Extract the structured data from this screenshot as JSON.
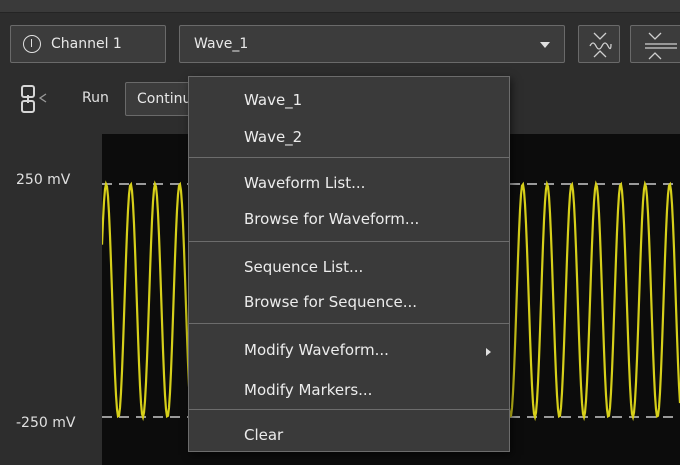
{
  "toolbar": {
    "channel_label": "Channel 1",
    "waveform_selected": "Wave_1",
    "run_label": "Run",
    "run_mode_value": "Continuous"
  },
  "plot": {
    "y_max_label": "250 mV",
    "y_min_label": "-250 mV",
    "trace_color": "#d6cf1a",
    "background_color": "#0c0c0c"
  },
  "menu": {
    "items": [
      {
        "label": "Wave_1"
      },
      {
        "label": "Wave_2"
      },
      {
        "label": "Waveform List..."
      },
      {
        "label": "Browse for Waveform..."
      },
      {
        "label": "Sequence List..."
      },
      {
        "label": "Browse for Sequence..."
      },
      {
        "label": "Modify Waveform...",
        "has_submenu": true
      },
      {
        "label": "Modify Markers..."
      },
      {
        "label": "Clear"
      }
    ]
  },
  "icons": {
    "channel": "power-icon",
    "dropdown": "chevron-down-icon",
    "waveform_toggle": "waveform-icon",
    "collapse": "collapse-icon",
    "link": "link-icon",
    "submenu": "chevron-right-icon"
  }
}
